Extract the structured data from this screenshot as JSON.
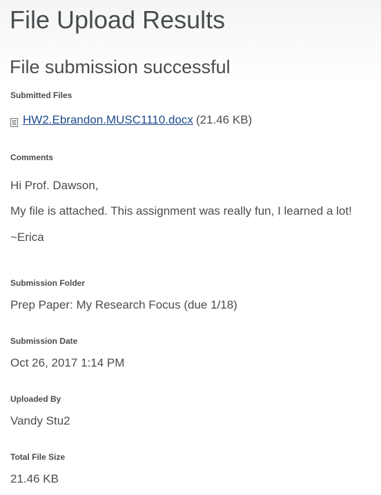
{
  "page": {
    "title": "File Upload Results",
    "success_heading": "File submission successful"
  },
  "submitted_files": {
    "label": "Submitted Files",
    "files": [
      {
        "name": "HW2.Ebrandon.MUSC1110.docx",
        "size": "(21.46 KB)",
        "icon": "document-icon"
      }
    ]
  },
  "comments": {
    "label": "Comments",
    "lines": [
      "Hi Prof. Dawson,",
      "My file is attached. This assignment was really fun, I learned a lot!",
      "~Erica"
    ]
  },
  "submission_folder": {
    "label": "Submission Folder",
    "value": "Prep Paper: My Research Focus (due 1/18)"
  },
  "submission_date": {
    "label": "Submission Date",
    "value": "Oct 26, 2017 1:14 PM"
  },
  "uploaded_by": {
    "label": "Uploaded By",
    "value": "Vandy Stu2"
  },
  "total_file_size": {
    "label": "Total File Size",
    "value": "21.46 KB"
  },
  "colors": {
    "text": "#494c4e",
    "link": "#1e4b8c",
    "header_background": "#f4f5f6"
  }
}
